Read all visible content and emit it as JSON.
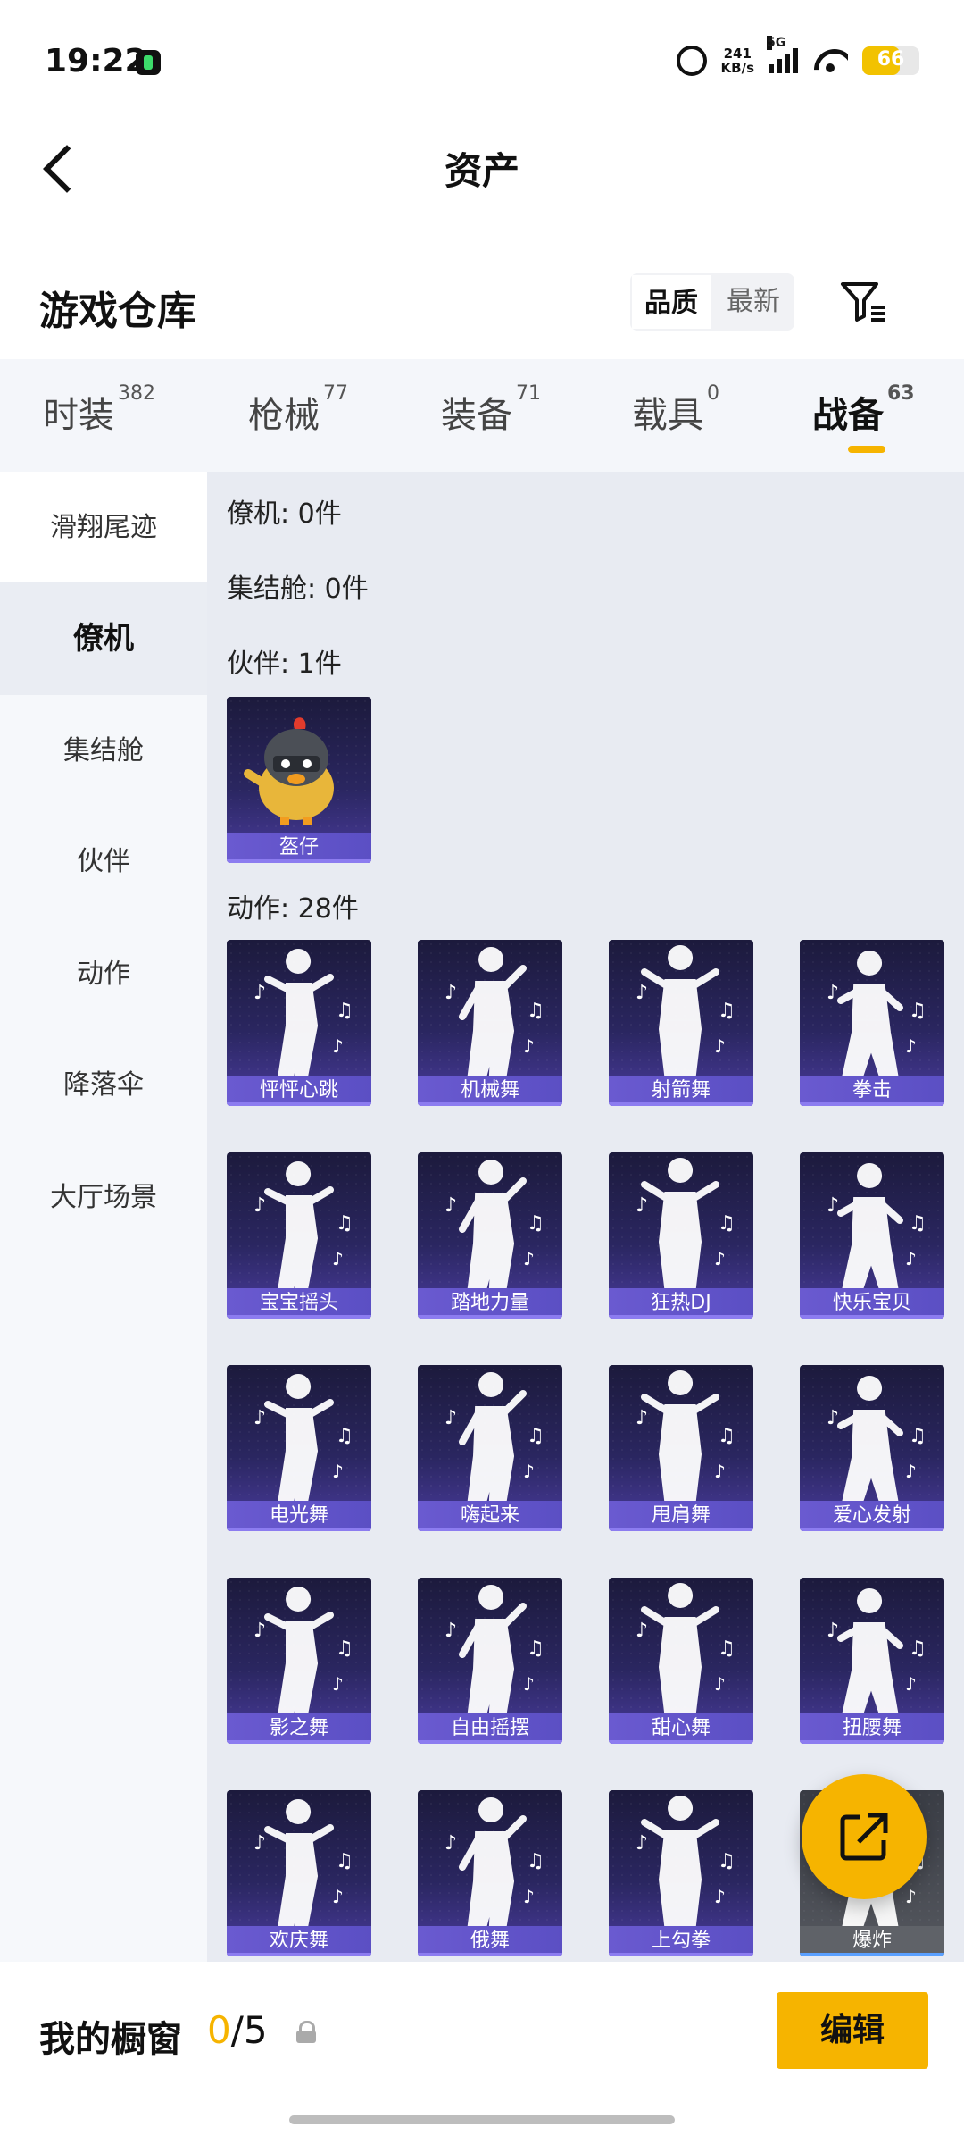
{
  "status_bar": {
    "time": "19:22",
    "net_speed_value": "241",
    "net_speed_unit": "KB/s",
    "network": "5G",
    "battery": "66",
    "battery_level": 0.66,
    "icons": [
      "app-icon",
      "alarm-icon",
      "signal-icon",
      "wifi-icon",
      "battery-icon"
    ]
  },
  "header": {
    "title": "资产",
    "back_icon": "back-arrow-icon"
  },
  "warehouse": {
    "title": "游戏仓库",
    "sort": {
      "quality": "品质",
      "newest": "最新",
      "selected": "品质"
    },
    "filter_icon": "filter-icon"
  },
  "tabs": [
    {
      "label": "时装",
      "count": "382"
    },
    {
      "label": "枪械",
      "count": "77"
    },
    {
      "label": "装备",
      "count": "71"
    },
    {
      "label": "载具",
      "count": "0"
    },
    {
      "label": "战备",
      "count": "63",
      "active": true
    }
  ],
  "side_menu": [
    {
      "label": "滑翔尾迹"
    },
    {
      "label": "僚机",
      "active": true
    },
    {
      "label": "集结舱"
    },
    {
      "label": "伙伴"
    },
    {
      "label": "动作"
    },
    {
      "label": "降落伞"
    },
    {
      "label": "大厅场景"
    }
  ],
  "groups": {
    "wingman": "僚机: 0件",
    "rally_pod": "集结舱: 0件",
    "partner": "伙伴: 1件",
    "emote": "动作: 28件"
  },
  "partner_items": [
    {
      "name": "盔仔"
    }
  ],
  "emote_items": [
    {
      "name": "怦怦心跳"
    },
    {
      "name": "机械舞"
    },
    {
      "name": "射箭舞"
    },
    {
      "name": "拳击"
    },
    {
      "name": "宝宝摇头"
    },
    {
      "name": "踏地力量"
    },
    {
      "name": "狂热DJ"
    },
    {
      "name": "快乐宝贝"
    },
    {
      "name": "电光舞"
    },
    {
      "name": "嗨起来"
    },
    {
      "name": "甩肩舞"
    },
    {
      "name": "爱心发射"
    },
    {
      "name": "影之舞"
    },
    {
      "name": "自由摇摆"
    },
    {
      "name": "甜心舞"
    },
    {
      "name": "扭腰舞"
    },
    {
      "name": "欢庆舞"
    },
    {
      "name": "俄舞"
    },
    {
      "name": "上勾拳"
    },
    {
      "name": "爆炸"
    }
  ],
  "bottom_bar": {
    "showcase_label": "我的橱窗",
    "showcase_current": "0",
    "showcase_total": "/5",
    "edit_label": "编辑"
  },
  "colors": {
    "accent": "#f6b400",
    "card_top": "#1c1a3c",
    "card_bottom": "#4a3c9e"
  }
}
